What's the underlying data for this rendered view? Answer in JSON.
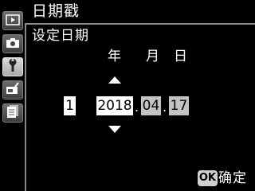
{
  "header": {
    "title": "日期戳"
  },
  "main": {
    "subtitle": "设定日期",
    "columns": [
      "年",
      "月",
      "日"
    ],
    "format_index": "1",
    "fields": {
      "year": "2018",
      "month": "04",
      "day": "17"
    },
    "separator": "."
  },
  "footer": {
    "ok_badge": "OK",
    "confirm_label": "确定"
  },
  "sidebar": {
    "tabs": [
      {
        "icon": "playback-icon"
      },
      {
        "icon": "camera-icon"
      },
      {
        "icon": "wrench-icon"
      },
      {
        "icon": "retouch-icon"
      },
      {
        "icon": "recent-settings-icon"
      }
    ],
    "active_index": 2
  },
  "colors": {
    "background": "#000000",
    "selected_field": "#ffffff",
    "field": "#c4c4c4",
    "rule": "#8a8a8a"
  }
}
